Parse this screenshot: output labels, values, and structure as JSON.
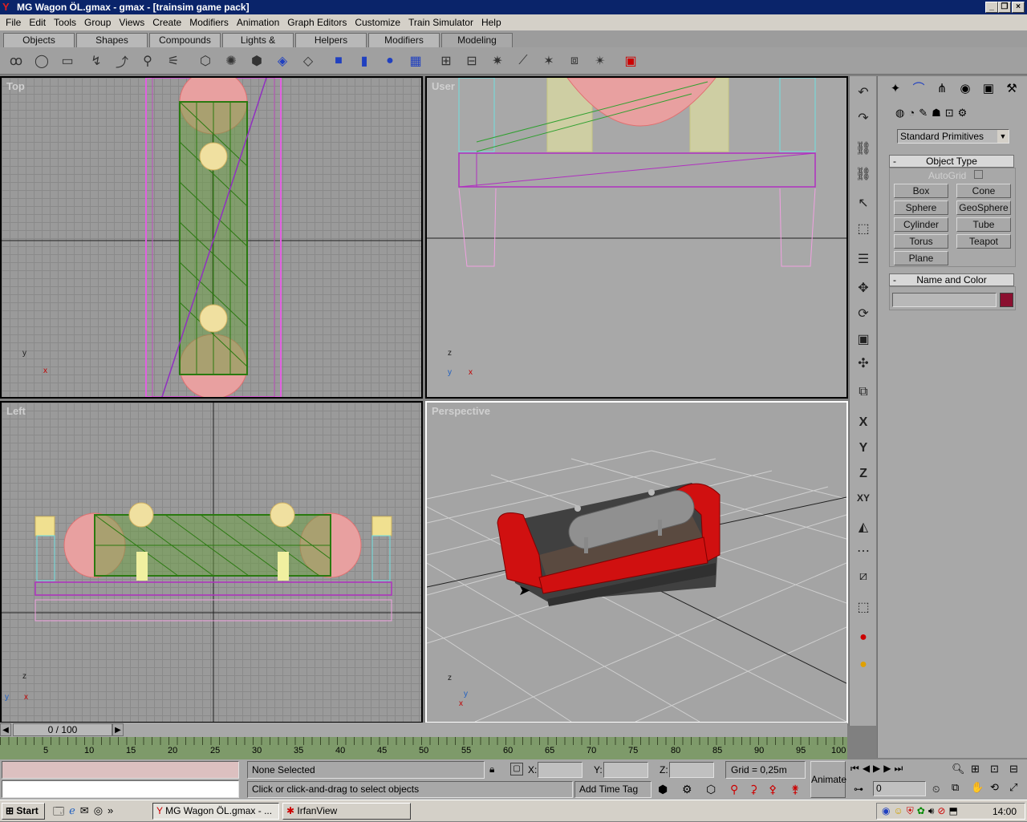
{
  "window": {
    "title": "MG Wagon ÖL.gmax - gmax - [trainsim game pack]"
  },
  "menu": [
    "File",
    "Edit",
    "Tools",
    "Group",
    "Views",
    "Create",
    "Modifiers",
    "Animation",
    "Graph Editors",
    "Customize",
    "Train Simulator",
    "Help"
  ],
  "tabs": [
    "Objects",
    "Shapes",
    "Compounds",
    "Lights & Cameras",
    "Helpers",
    "Modifiers",
    "Modeling"
  ],
  "active_tab": "Modeling",
  "viewports": {
    "top": "Top",
    "user": "User",
    "left": "Left",
    "perspective": "Perspective"
  },
  "axes": {
    "top": [
      "y",
      "x"
    ],
    "user": [
      "z",
      "y",
      "x"
    ],
    "left": [
      "z",
      "y",
      "x"
    ],
    "perspective": [
      "z",
      "y",
      "x"
    ]
  },
  "command_panel": {
    "dropdown": "Standard Primitives",
    "object_type": {
      "header": "Object Type",
      "autogrid": "AutoGrid",
      "buttons": [
        "Box",
        "Cone",
        "Sphere",
        "GeoSphere",
        "Cylinder",
        "Tube",
        "Torus",
        "Teapot",
        "Plane"
      ]
    },
    "name_color": {
      "header": "Name and Color",
      "name_value": "",
      "swatch": "#8a1030"
    }
  },
  "time": {
    "slider": "0 / 100",
    "ticks": [
      "5",
      "10",
      "15",
      "20",
      "25",
      "30",
      "35",
      "40",
      "45",
      "50",
      "55",
      "60",
      "65",
      "70",
      "75",
      "80",
      "85",
      "90",
      "95",
      "100"
    ]
  },
  "status": {
    "selection": "None Selected",
    "prompt": "Click or click-and-drag to select objects",
    "x_label": "X:",
    "y_label": "Y:",
    "z_label": "Z:",
    "grid": "Grid = 0,25m",
    "add_time_tag": "Add Time Tag",
    "animate": "Animate",
    "frame": "0"
  },
  "taskbar": {
    "start": "Start",
    "tasks": [
      "MG Wagon ÖL.gmax - ...",
      "IrfanView"
    ],
    "clock": "14:00"
  }
}
